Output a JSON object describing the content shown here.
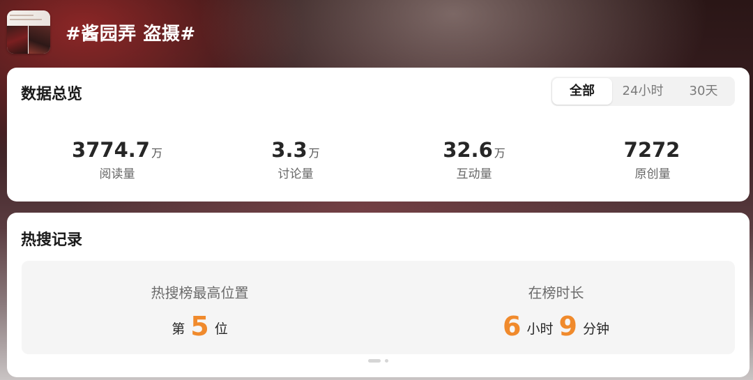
{
  "header": {
    "hashtag": "#酱园弄 盗摄#",
    "thumbnail_icon": "topic-thumbnail-image"
  },
  "overview": {
    "title": "数据总览",
    "tabs": [
      {
        "label": "全部",
        "active": true
      },
      {
        "label": "24小时",
        "active": false
      },
      {
        "label": "30天",
        "active": false
      }
    ],
    "stats": [
      {
        "value": "3774.7",
        "unit": "万",
        "label": "阅读量"
      },
      {
        "value": "3.3",
        "unit": "万",
        "label": "讨论量"
      },
      {
        "value": "32.6",
        "unit": "万",
        "label": "互动量"
      },
      {
        "value": "7272",
        "unit": "",
        "label": "原创量"
      }
    ]
  },
  "hot_search": {
    "title": "热搜记录",
    "highest_rank": {
      "label": "热搜榜最高位置",
      "prefix": "第",
      "value": "5",
      "suffix": "位"
    },
    "duration": {
      "label": "在榜时长",
      "hours": "6",
      "hours_unit": "小时",
      "minutes": "9",
      "minutes_unit": "分钟"
    },
    "accent_color": "#f08a2c"
  }
}
